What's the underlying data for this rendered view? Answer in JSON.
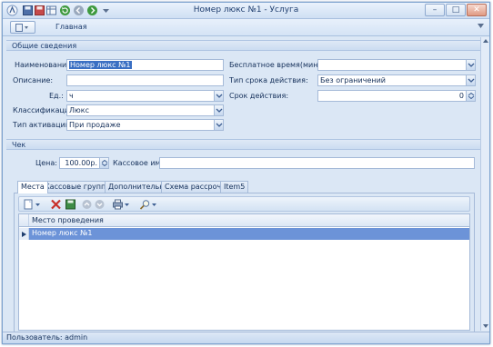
{
  "window": {
    "title": "Номер люкс №1 - Услуга",
    "minimize": "–",
    "maximize": "□",
    "close": "✕"
  },
  "ribbon": {
    "tab_home": "Главная"
  },
  "general": {
    "section_title": "Общие сведения",
    "name_label": "Наименование:",
    "name_value": "Номер люкс №1",
    "description_label": "Описание:",
    "description_value": "",
    "unit_label": "Ед.:",
    "unit_value": "ч",
    "classification_label": "Классификация:",
    "classification_value": "Люкс",
    "activation_label": "Тип активации:",
    "activation_value": "При продаже",
    "free_time_label": "Бесплатное время(мин):",
    "free_time_value": "",
    "term_type_label": "Тип срока действия:",
    "term_type_value": "Без ограничений",
    "term_label": "Срок действия:",
    "term_value": "0"
  },
  "check": {
    "section_title": "Чек",
    "price_label": "Цена:",
    "price_value": "100.00р.",
    "cash_name_label": "Кассовое имя:",
    "cash_name_value": ""
  },
  "tabs": [
    {
      "label": "Места"
    },
    {
      "label": "Кассовые группы"
    },
    {
      "label": "Дополнительно"
    },
    {
      "label": "Схема рассрочки"
    },
    {
      "label": "Item5"
    }
  ],
  "grid": {
    "column": "Место проведения",
    "rows": [
      {
        "place": "Номер люкс №1"
      }
    ]
  },
  "status": {
    "user": "Пользователь: admin"
  },
  "colors": {
    "accent": "#3a6fc3",
    "selected_row": "#6c93d8",
    "background": "#dbe7f5"
  }
}
